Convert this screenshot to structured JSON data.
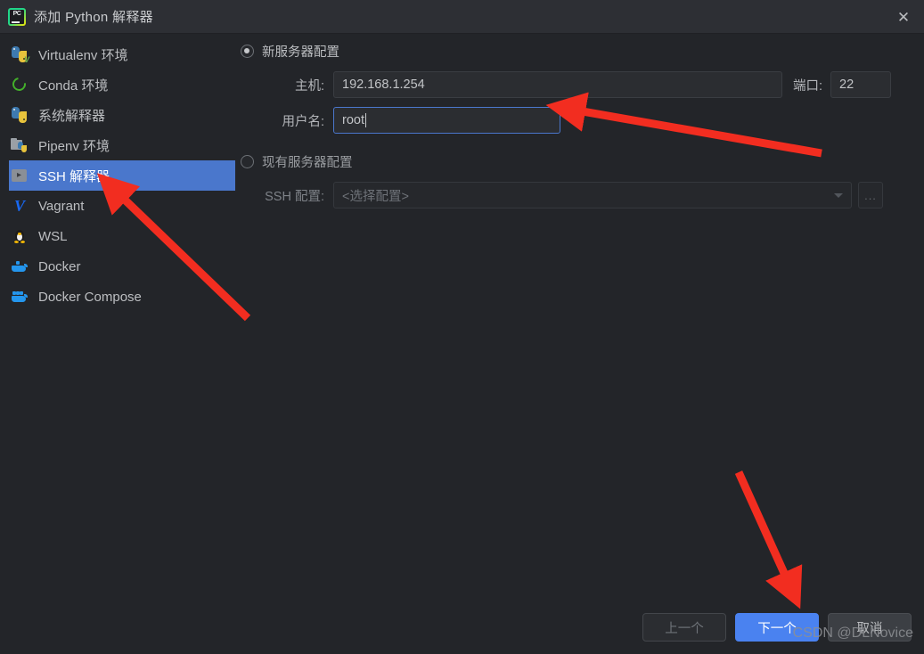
{
  "window": {
    "title": "添加 Python 解释器",
    "app_icon": "pycharm-icon",
    "close_icon": "close-icon"
  },
  "sidebar": {
    "items": [
      {
        "label": "Virtualenv 环境",
        "icon": "python-virtualenv-icon",
        "selected": false
      },
      {
        "label": "Conda 环境",
        "icon": "conda-icon",
        "selected": false
      },
      {
        "label": "系统解释器",
        "icon": "python-icon",
        "selected": false
      },
      {
        "label": "Pipenv 环境",
        "icon": "pipenv-folder-icon",
        "selected": false
      },
      {
        "label": "SSH 解释器",
        "icon": "ssh-terminal-icon",
        "selected": true
      },
      {
        "label": "Vagrant",
        "icon": "vagrant-icon",
        "selected": false
      },
      {
        "label": "WSL",
        "icon": "wsl-penguin-icon",
        "selected": false
      },
      {
        "label": "Docker",
        "icon": "docker-whale-icon",
        "selected": false
      },
      {
        "label": "Docker Compose",
        "icon": "docker-compose-icon",
        "selected": false
      }
    ]
  },
  "panel": {
    "new_server": {
      "radio_label": "新服务器配置",
      "selected": true,
      "host_label": "主机:",
      "host_value": "192.168.1.254",
      "port_label": "端口:",
      "port_value": "22",
      "username_label": "用户名:",
      "username_value": "root"
    },
    "existing_server": {
      "radio_label": "现有服务器配置",
      "selected": false,
      "ssh_config_label": "SSH 配置:",
      "ssh_config_value": "<选择配置>",
      "browse_label": "...",
      "dropdown_icon": "chevron-down-icon"
    }
  },
  "footer": {
    "previous_label": "上一个",
    "next_label": "下一个",
    "cancel_label": "取消"
  },
  "watermark": {
    "text": "CSDN @DLNovice"
  },
  "colors": {
    "background": "#232529",
    "titlebar": "#2d2f34",
    "selection_blue": "#4a77cc",
    "primary_button": "#4a82f0",
    "focus_border": "#4a77cc",
    "annotation_red": "#f22d20"
  }
}
